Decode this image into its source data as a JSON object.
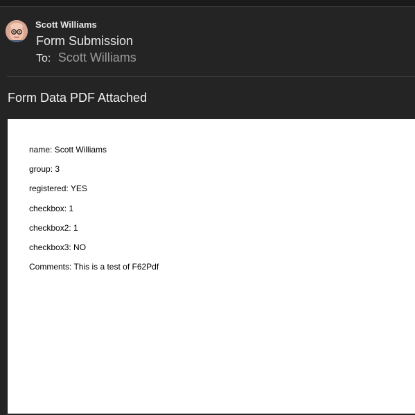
{
  "message": {
    "sender": "Scott Williams",
    "subject": "Form Submission",
    "to_label": "To:",
    "to_value": "Scott Williams",
    "body_title": "Form Data PDF Attached"
  },
  "pdf": {
    "fields": [
      "name: Scott Williams",
      "group: 3",
      "registered: YES",
      "checkbox: 1",
      "checkbox2: 1",
      "checkbox3: NO",
      "Comments: This is a test of F62Pdf"
    ]
  },
  "icons": {
    "avatar": "avatar-memoji-icon"
  },
  "colors": {
    "window_bg": "#242424",
    "text_primary": "#e6e6e6",
    "text_secondary": "#9a9a9a",
    "pdf_bg": "#ffffff"
  }
}
